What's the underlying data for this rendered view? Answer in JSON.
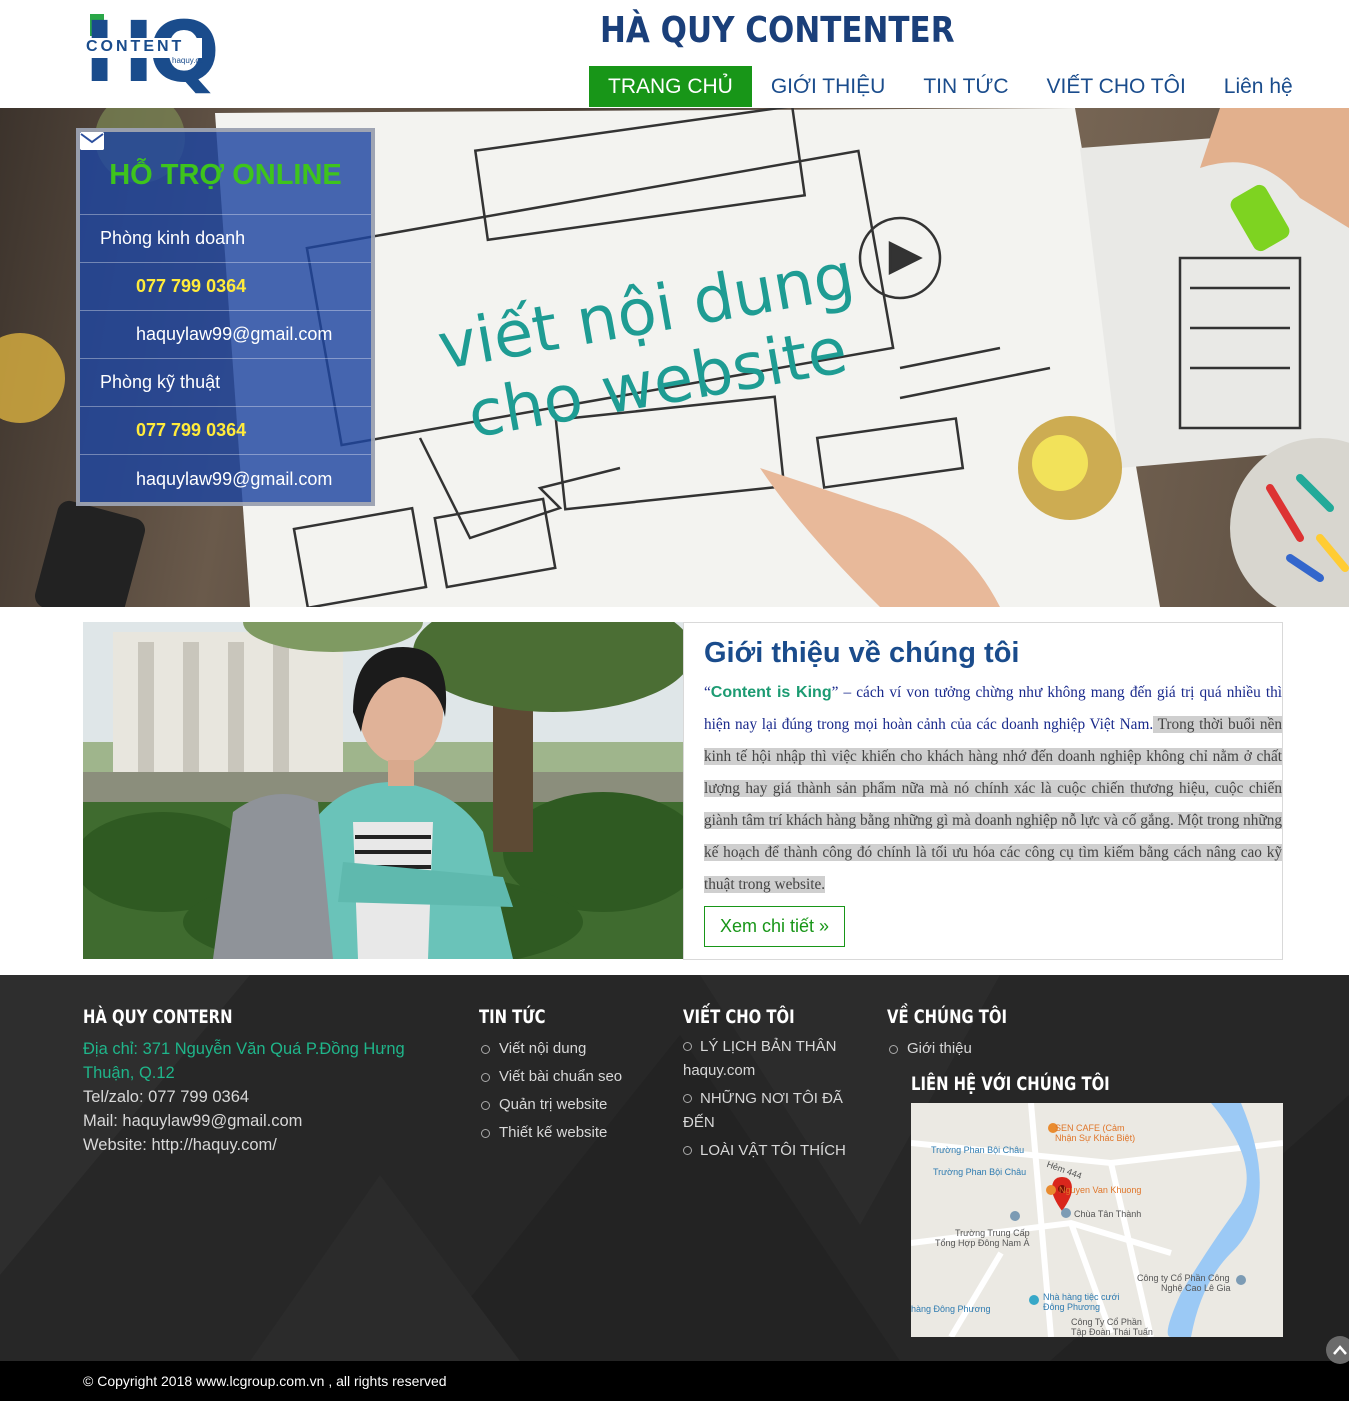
{
  "header": {
    "logo": {
      "letters": "HQ",
      "word": "CONTENT",
      "sub": "haquy.com"
    },
    "site_title": "HÀ QUY CONTENTER",
    "nav": [
      {
        "label": "TRANG CHỦ",
        "active": true
      },
      {
        "label": "GIỚI THIỆU"
      },
      {
        "label": "TIN TỨC"
      },
      {
        "label": "VIẾT CHO TÔI"
      },
      {
        "label": "Liên hệ"
      }
    ]
  },
  "hero": {
    "headline_line1": "viết nội dung",
    "headline_line2": "cho website",
    "support": {
      "title": "HỖ TRỢ ONLINE",
      "departments": [
        {
          "name": "Phòng kinh doanh",
          "phone": "077 799 0364",
          "email": "haquylaw99@gmail.com"
        },
        {
          "name": "Phòng kỹ thuật",
          "phone": "077 799 0364",
          "email": "haquylaw99@gmail.com"
        }
      ]
    }
  },
  "intro": {
    "title": "Giới thiệu về chúng tôi",
    "quote_open": "“",
    "king": "Content is King",
    "quote_close": "”",
    "text_part1": " – cách ví von tưởng chừng như không mang đến giá trị quá nhiều thì hiện nay lại đúng trong mọi hoàn cảnh của các doanh nghiệp Việt Nam.",
    "text_highlight": " Trong thời buổi nền kinh tế hội nhập thì việc khiến cho khách hàng nhớ đến doanh nghiệp không chỉ nằm ở chất lượng hay giá thành sản phẩm nữa mà nó chính xác là cuộc chiến thương hiệu, cuộc chiến giành tâm trí khách hàng bằng những gì mà doanh nghiệp nỗ lực và cố gắng. Một trong những kế hoạch để thành công đó chính là tối ưu hóa các công cụ tìm kiếm bằng cách nâng cao kỹ thuật trong website.",
    "button": "Xem chi tiết »"
  },
  "footer": {
    "col1": {
      "heading": "HÀ QUY CONTERN",
      "address": "Địa chỉ: 371 Nguyễn Văn Quá P.Đồng Hưng Thuận, Q.12",
      "tel": "Tel/zalo: 077 799 0364",
      "mail": "Mail: haquylaw99@gmail.com",
      "website": "Website: http://haquy.com/"
    },
    "col2": {
      "heading": "TIN TỨC",
      "items": [
        "Viết nội dung",
        "Viết bài chuẩn seo",
        "Quản trị website",
        "Thiết kế website"
      ]
    },
    "col3": {
      "heading": "VIẾT CHO TÔI",
      "items": [
        {
          "label": "LÝ LỊCH BẢN THÂN haquy.com"
        },
        {
          "label": "NHỮNG NƠI TÔI ĐÃ ĐẾN"
        },
        {
          "label": "LOÀI VẬT TÔI THÍCH"
        }
      ]
    },
    "col4": {
      "heading": "VỀ CHÚNG TÔI",
      "items": [
        "Giới thiệu"
      ],
      "contact_heading": "LIÊN HỆ VỚI CHÚNG TÔI"
    },
    "map": {
      "labels": [
        "SEN CAFE (Cảm",
        "Nhận Sự Khác Biệt)",
        "Trường Phan Bội Châu",
        "Trường Phan Bội Châu",
        "Hẻm 444",
        "Nguyen Van Khuong",
        "Chùa Tân Thành",
        "Trường Trung Cấp",
        "Tổng Hợp Đông Nam Á",
        "Công ty Cổ Phần Công",
        "Nghệ Cao Lê Gia",
        "Nhà hàng tiệc cưới",
        "Đông Phương",
        "hàng Đông Phương",
        "Công Ty Cổ Phần",
        "Tập Đoàn Thái Tuấn"
      ]
    },
    "copyright": "© Copyright 2018 www.lcgroup.com.vn , all rights reserved"
  },
  "colors": {
    "brand_blue": "#1a4c8c",
    "nav_active": "#189618",
    "support_title": "#3ec41c",
    "phone": "#ffeb3b",
    "address": "#1fb58a",
    "footer_bg": "#272727"
  },
  "icons": {
    "phone": "phone-icon",
    "email": "envelope-icon",
    "scroll_top": "chevron-up-icon",
    "map_pin": "map-pin-icon"
  }
}
